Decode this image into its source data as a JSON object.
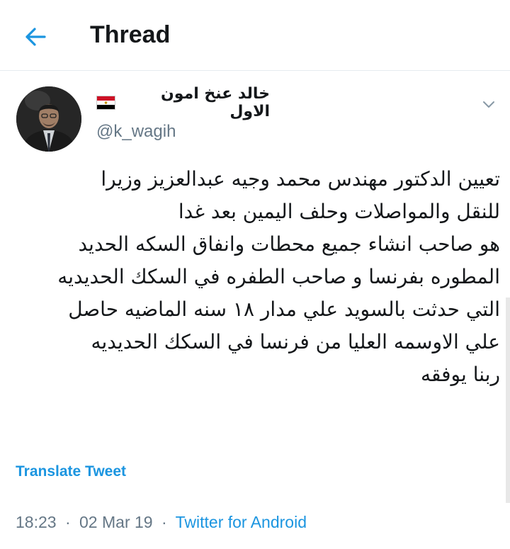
{
  "header": {
    "title": "Thread",
    "back_icon": "arrow-left-icon"
  },
  "tweet": {
    "display_name": "خالد عنخ امون الاول",
    "flag_icon": "egypt-flag-icon",
    "handle": "@k_wagih",
    "text_lines": [
      "تعيين الدكتور مهندس محمد وجيه عبدالعزيز وزيرا",
      "للنقل والمواصلات وحلف اليمين بعد غدا",
      "هو صاحب انشاء جميع محطات وانفاق السكه الحديد",
      "المطوره بفرنسا و صاحب الطفره في السكك الحديديه",
      "التي حدثت بالسويد علي مدار ١٨ سنه الماضيه حاصل",
      "علي الاوسمه العليا من فرنسا في السكك الحديديه",
      "ربنا يوفقه"
    ],
    "translate_label": "Translate Tweet",
    "time": "18:23",
    "date": "02 Mar 19",
    "separator": "·",
    "source": "Twitter for Android"
  },
  "colors": {
    "accent": "#1b95e0",
    "muted": "#657786",
    "text": "#14171a"
  }
}
